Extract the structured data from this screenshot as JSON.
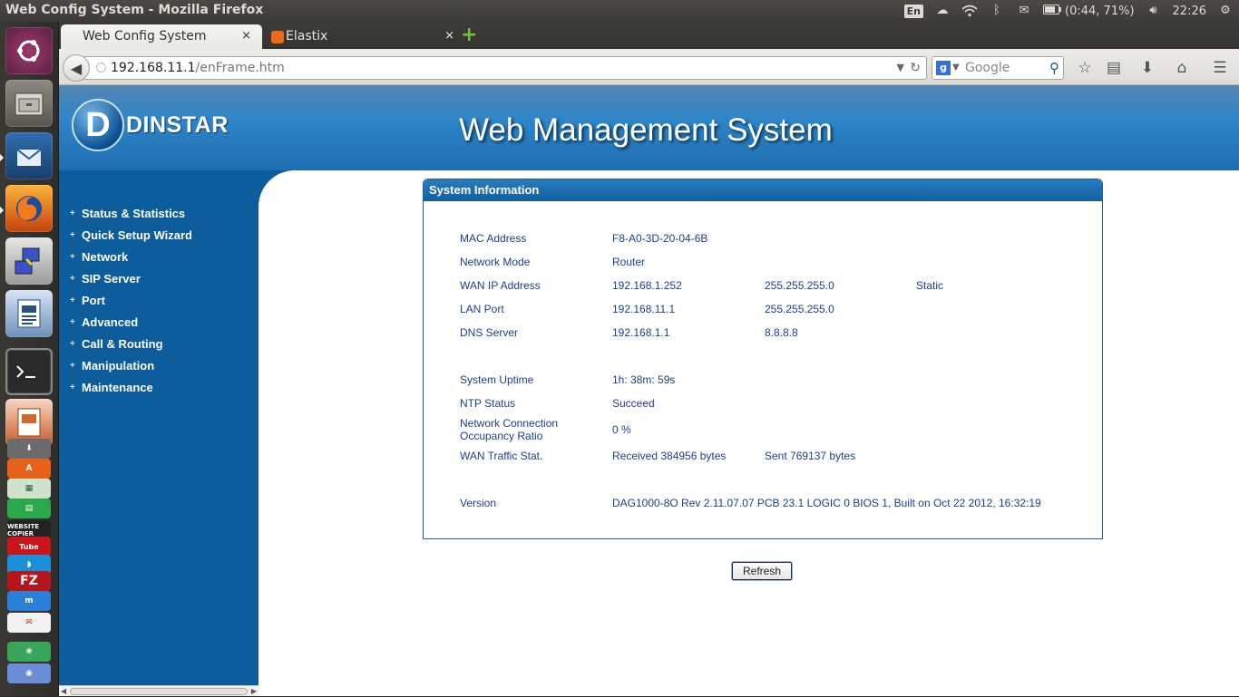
{
  "top_panel": {
    "window_title": "Web Config System - Mozilla Firefox",
    "keyboard_layout": "En",
    "battery_text": "(0:44, 71%)",
    "clock": "22:26"
  },
  "launcher": {
    "apps": [
      "ubuntu-dash",
      "files",
      "thunderbird",
      "firefox",
      "remote-desktop",
      "libreoffice-writer",
      "terminal",
      "libreoffice-impress",
      "software-updater",
      "ubuntu-software-center",
      "spreadsheet",
      "website-copier",
      "youtube",
      "filezilla",
      "app-blue",
      "app-gmail",
      "app-green",
      "app-purple"
    ],
    "website_copier_label": "WEBSITE COPIER",
    "youtube_label": "Tube"
  },
  "browser": {
    "tabs": [
      {
        "label": "Web Config System",
        "close": "×"
      },
      {
        "label": "Elastix",
        "close": "×"
      }
    ],
    "new_tab": "+",
    "url_host": "192.168.11.1",
    "url_path": "/enFrame.htm",
    "search_placeholder": "Google"
  },
  "site": {
    "brand": "DINSTAR",
    "title": "Web Management System",
    "menu": [
      "Status & Statistics",
      "Quick Setup Wizard",
      "Network",
      "SIP Server",
      "Port",
      "Advanced",
      "Call & Routing",
      "Manipulation",
      "Maintenance"
    ]
  },
  "system_info": {
    "heading": "System Information",
    "mac_label": "MAC Address",
    "mac_value": "F8-A0-3D-20-04-6B",
    "mode_label": "Network Mode",
    "mode_value": "Router",
    "wan_label": "WAN IP Address",
    "wan_ip": "192.168.1.252",
    "wan_mask": "255.255.255.0",
    "wan_type": "Static",
    "lan_label": "LAN Port",
    "lan_ip": "192.168.11.1",
    "lan_mask": "255.255.255.0",
    "dns_label": "DNS Server",
    "dns_primary": "192.168.1.1",
    "dns_secondary": "8.8.8.8",
    "uptime_label": "System Uptime",
    "uptime_value": "1h: 38m: 59s",
    "ntp_label": "NTP Status",
    "ntp_value": "Succeed",
    "occupancy_label_1": "Network Connection",
    "occupancy_label_2": "Occupancy Ratio",
    "occupancy_value": "0 %",
    "traffic_label": "WAN  Traffic Stat.",
    "traffic_received": "Received  384956  bytes",
    "traffic_sent": "Sent  769137  bytes",
    "version_label": "Version",
    "version_value": "DAG1000-8O Rev 2.11.07.07 PCB 23.1 LOGIC 0 BIOS 1, Built on Oct 22 2012, 16:32:19"
  },
  "refresh_label": "Refresh"
}
